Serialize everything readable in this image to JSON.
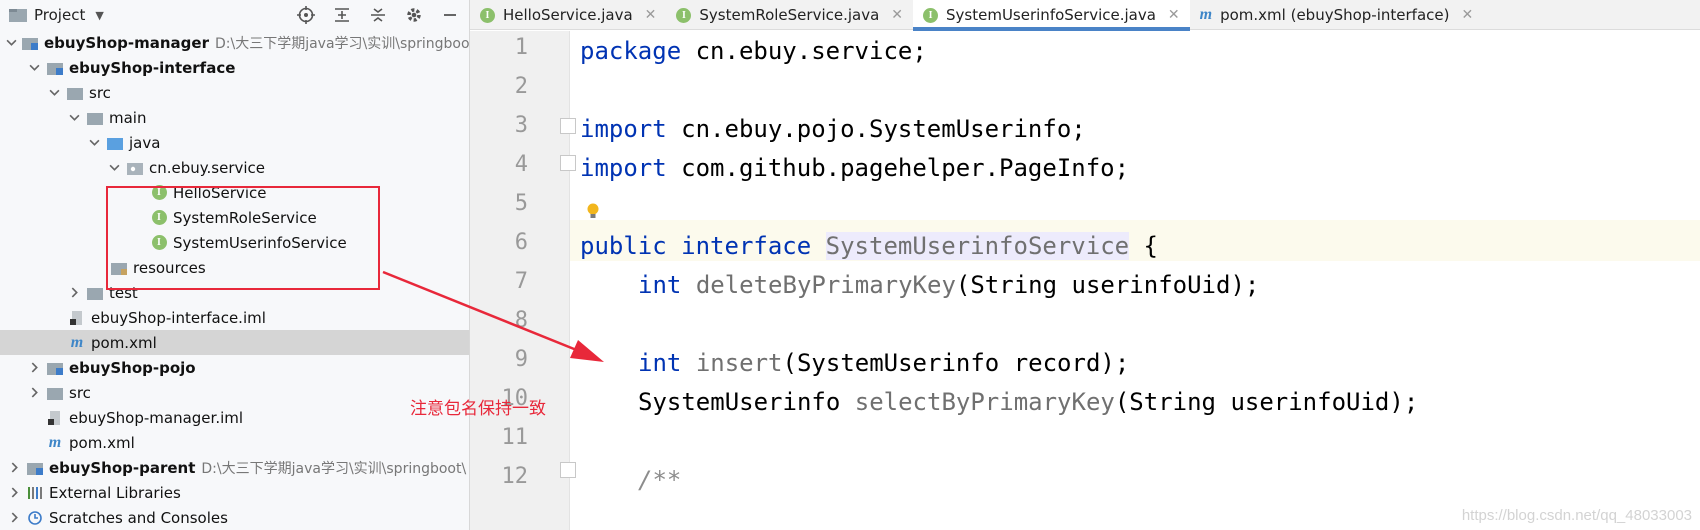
{
  "project_panel": {
    "title": "Project",
    "tree": [
      {
        "name": "ebuyShop-manager",
        "path": "D:\\大三下学期java学习\\实训\\springboo",
        "bold": true
      },
      {
        "name": "ebuyShop-interface",
        "bold": true
      },
      {
        "name": "src"
      },
      {
        "name": "main"
      },
      {
        "name": "java"
      },
      {
        "name": "cn.ebuy.service"
      },
      {
        "name": "HelloService"
      },
      {
        "name": "SystemRoleService"
      },
      {
        "name": "SystemUserinfoService"
      },
      {
        "name": "resources"
      },
      {
        "name": "test"
      },
      {
        "name": "ebuyShop-interface.iml"
      },
      {
        "name": "pom.xml"
      },
      {
        "name": "ebuyShop-pojo",
        "bold": true
      },
      {
        "name": "src"
      },
      {
        "name": "ebuyShop-manager.iml"
      },
      {
        "name": "pom.xml"
      },
      {
        "name": "ebuyShop-parent",
        "path": "D:\\大三下学期java学习\\实训\\springboot\\",
        "bold": true
      },
      {
        "name": "External Libraries"
      },
      {
        "name": "Scratches and Consoles"
      }
    ]
  },
  "tabs": [
    {
      "label": "HelloService.java",
      "active": false
    },
    {
      "label": "SystemRoleService.java",
      "active": false
    },
    {
      "label": "SystemUserinfoService.java",
      "active": true
    },
    {
      "label": "pom.xml (ebuyShop-interface)",
      "active": false
    }
  ],
  "editor": {
    "line_numbers": [
      "1",
      "2",
      "3",
      "4",
      "5",
      "6",
      "7",
      "8",
      "9",
      "10",
      "11",
      "12"
    ],
    "code": {
      "l1_kw": "package",
      "l1_rest": " cn.ebuy.service;",
      "l3_kw": "import",
      "l3_rest": " cn.ebuy.pojo.SystemUserinfo;",
      "l4_kw": "import",
      "l4_rest": " com.github.pagehelper.PageInfo;",
      "l6_kw1": "public",
      "l6_kw2": "interface",
      "l6_name": "SystemUserinfoService",
      "l6_rest": " {",
      "l7_kw": "int",
      "l7_method": "deleteByPrimaryKey",
      "l7_rest": "(String userinfoUid);",
      "l9_kw": "int",
      "l9_method": "insert",
      "l9_rest": "(SystemUserinfo record);",
      "l10_type": "SystemUserinfo",
      "l10_method": "selectByPrimaryKey",
      "l10_rest": "(String userinfoUid);",
      "l12_comment": "/**"
    }
  },
  "annotation": {
    "text": "注意包名保持一致",
    "color": "#e8283a"
  },
  "watermark": "https://blog.csdn.net/qq_48033003",
  "colors": {
    "keyword": "#0033b3",
    "interface_badge": "#8cc06b",
    "active_tab_underline": "#4a83c7",
    "annotation_red": "#e8283a"
  }
}
